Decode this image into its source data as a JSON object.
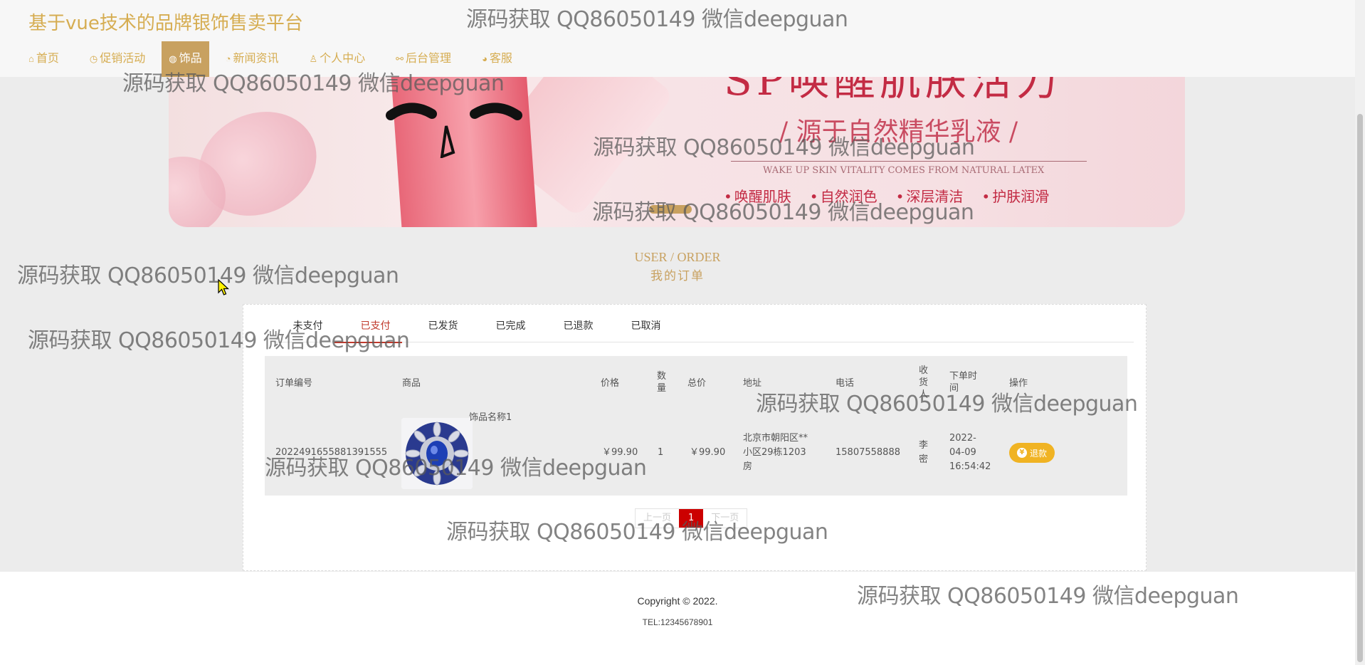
{
  "site_title": "基于vue技术的品牌银饰售卖平台",
  "nav": [
    {
      "icon": "⌂",
      "label": "首页"
    },
    {
      "icon": "◷",
      "label": "促销活动"
    },
    {
      "icon": "◍",
      "label": "饰品",
      "active": true
    },
    {
      "icon": "◔",
      "label": "新闻资讯"
    },
    {
      "icon": "♙",
      "label": "个人中心"
    },
    {
      "icon": "⚯",
      "label": "后台管理"
    },
    {
      "icon": "◕",
      "label": "客服"
    }
  ],
  "banner": {
    "headline": "SP唤醒肌肤活力",
    "sub": "/ 源于自然精华乳液 /",
    "english": "WAKE UP SKIN VITALITY COMES FROM NATURAL LATEX",
    "tags": [
      "唤醒肌肤",
      "自然润色",
      "深层清洁",
      "护肤润滑"
    ]
  },
  "section": {
    "english": "USER / ORDER",
    "chinese": "我的订单"
  },
  "tabs": [
    "未支付",
    "已支付",
    "已发货",
    "已完成",
    "已退款",
    "已取消"
  ],
  "active_tab": "已支付",
  "table": {
    "headers": {
      "order_no": "订单编号",
      "product": "商品",
      "price": "价格",
      "qty": "数\n量",
      "total": "总价",
      "address": "地址",
      "phone": "电话",
      "receiver": "收\n货\n人",
      "time": "下单时\n间",
      "action": "操作"
    },
    "rows": [
      {
        "order_no": "20224916558813915​55",
        "product_name": "饰品名称1",
        "price": "￥99.90",
        "qty": "1",
        "total": "￥99.90",
        "address": "北京市朝阳区**小区29栋1203房",
        "phone": "15807558888",
        "receiver": "李\n密",
        "time": "2022-\n04-09\n16:54:42",
        "action": "退款"
      }
    ]
  },
  "pagination": {
    "prev": "上一页",
    "current": "1",
    "next": "下一页"
  },
  "footer": {
    "copyright": "Copyright © 2022.",
    "tel": "TEL:12345678901"
  },
  "watermark": "源码获取 QQ86050149 微信deepguan",
  "colors": {
    "accent": "#d6ad52",
    "nav_active": "#c8a160",
    "refund": "#f0b323",
    "page_current": "#cc0000",
    "tab_active": "#c0392b"
  }
}
